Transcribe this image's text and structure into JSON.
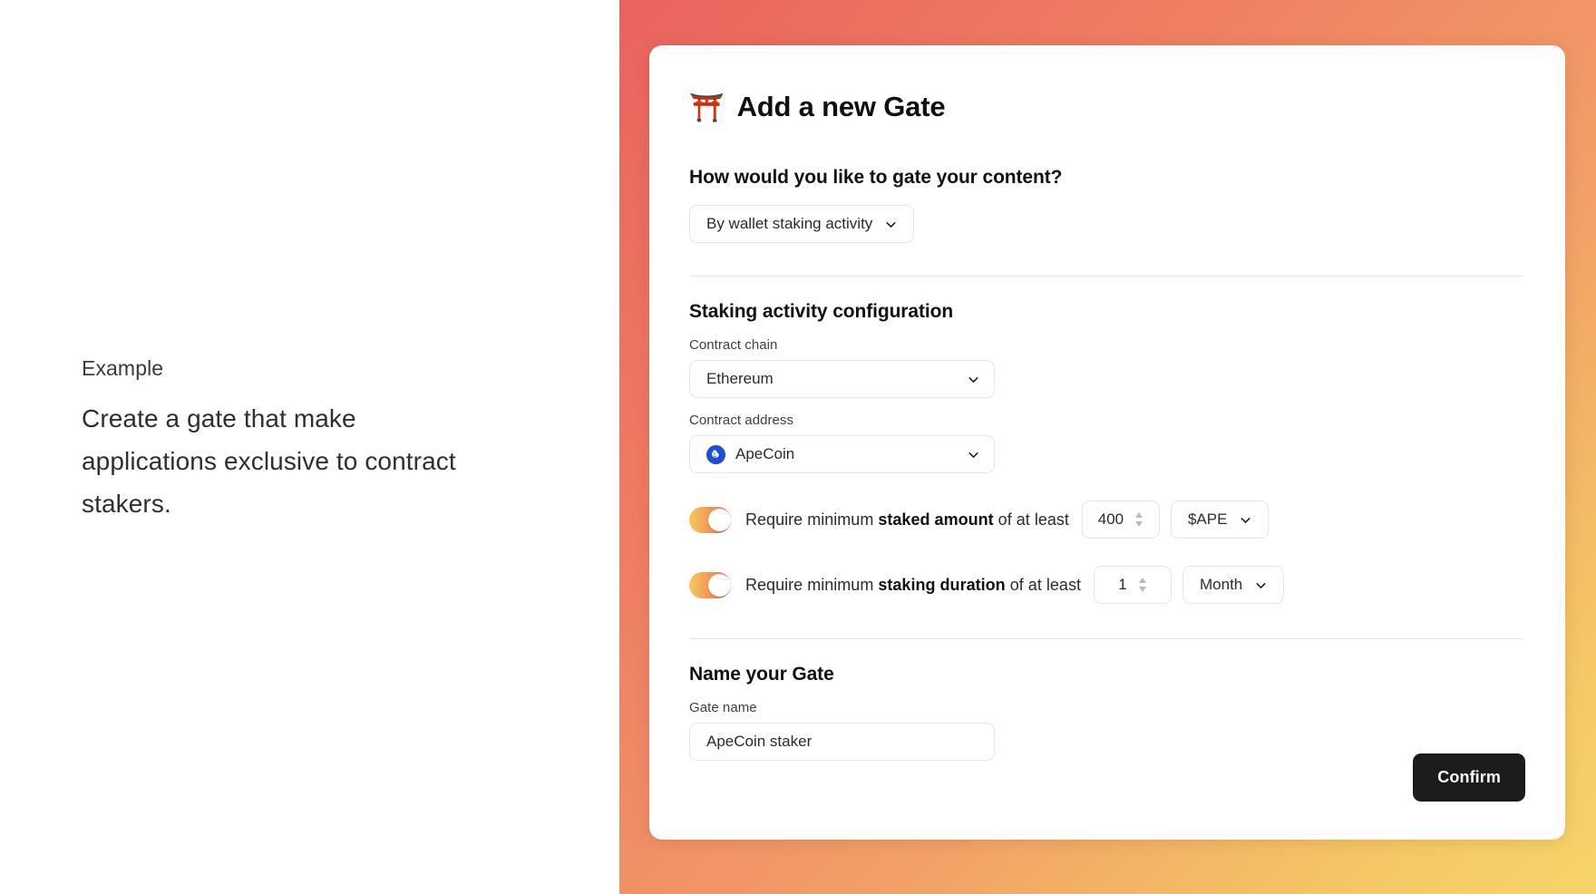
{
  "left": {
    "kicker": "Example",
    "description": "Create a gate that make applications exclusive to contract stakers."
  },
  "card": {
    "title_icon": "torii-gate-icon",
    "title_emoji": "⛩️",
    "title": "Add a new Gate",
    "gating": {
      "question": "How would you like to gate your content?",
      "selected": "By wallet staking activity"
    },
    "staking": {
      "section_title": "Staking activity configuration",
      "chain_label": "Contract chain",
      "chain_value": "Ethereum",
      "address_label": "Contract address",
      "address_value": "ApeCoin",
      "address_icon": "apecoin-icon",
      "amount_rule": {
        "toggle_state": "on",
        "text_prefix": "Require minimum ",
        "text_bold": "staked amount",
        "text_suffix": " of at least",
        "value": "400",
        "unit": "$APE"
      },
      "duration_rule": {
        "toggle_state": "on",
        "text_prefix": "Require minimum ",
        "text_bold": "staking duration",
        "text_suffix": " of at least",
        "value": "1",
        "unit": "Month"
      }
    },
    "name": {
      "section_title": "Name your Gate",
      "field_label": "Gate name",
      "value": "ApeCoin staker",
      "placeholder": "Gate name"
    },
    "confirm_label": "Confirm"
  },
  "colors": {
    "gradient_top_left": "#e9635e",
    "gradient_mid": "#f2a067",
    "gradient_bottom_right": "#f6d468",
    "confirm_bg": "#1c1c1c",
    "toggle_on_from": "#f6c863",
    "toggle_on_to": "#ec6a5c",
    "apecoin_blue": "#1f4fd8",
    "border": "#e7e7e9"
  }
}
